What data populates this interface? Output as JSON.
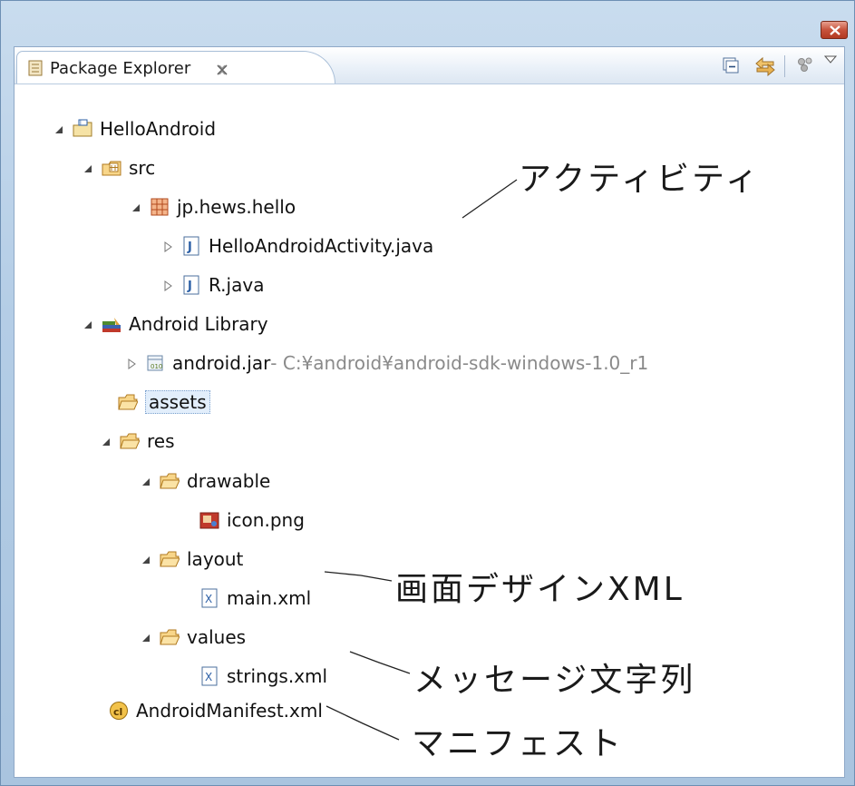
{
  "view": {
    "title": "Package Explorer",
    "toolbar_icons": [
      "collapse-all-icon",
      "link-with-editor-icon",
      "view-menu-icon"
    ]
  },
  "tree": {
    "project": "HelloAndroid",
    "src": "src",
    "package": "jp.hews.hello",
    "activity_file": "HelloAndroidActivity.java",
    "r_file": "R.java",
    "android_library": "Android Library",
    "jar_name": "android.jar",
    "jar_path": " - C:¥android¥android-sdk-windows-1.0_r1",
    "assets": "assets",
    "res": "res",
    "drawable": "drawable",
    "icon_file": "icon.png",
    "layout": "layout",
    "main_xml": "main.xml",
    "values": "values",
    "strings_xml": "strings.xml",
    "manifest": "AndroidManifest.xml"
  },
  "annotations": {
    "activity": "アクティビティ",
    "screen_design": "画面デザインXML",
    "message_strings": "メッセージ文字列",
    "manifest": "マニフェスト"
  },
  "colors": {
    "window_frame": "#b4cde6",
    "close_button": "#c7523b",
    "selection": "#e2eefb",
    "decoration_text": "#8a8a8a"
  }
}
